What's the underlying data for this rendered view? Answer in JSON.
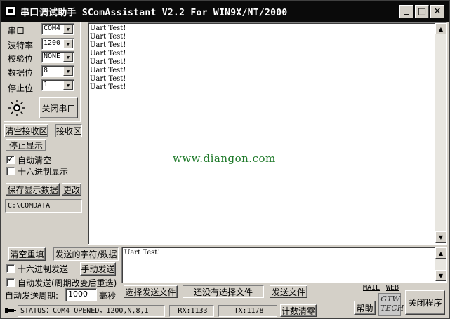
{
  "window": {
    "title": "串口调试助手 SComAssistant V2.2 For WIN9X/NT/2000",
    "minimize": "_",
    "maximize": "□",
    "close": "✕"
  },
  "settings": {
    "port_label": "串口",
    "port_value": "COM4",
    "baud_label": "波特率",
    "baud_value": "1200",
    "parity_label": "校验位",
    "parity_value": "NONE",
    "databits_label": "数据位",
    "databits_value": "8",
    "stopbits_label": "停止位",
    "stopbits_value": "1",
    "close_port_button": "关闭串口"
  },
  "receive": {
    "clear_recv_button": "清空接收区",
    "recv_area_label": "接收区",
    "stop_display_button": "停止显示",
    "auto_clear_label": "自动清空",
    "auto_clear_checked": true,
    "hex_display_label": "十六进制显示",
    "hex_display_checked": false,
    "save_data_button": "保存显示数据",
    "change_button": "更改",
    "save_path": "C:\\COMDATA",
    "lines": [
      "Uart Test!",
      "Uart Test!",
      "Uart Test!",
      "Uart Test!",
      "Uart Test!",
      "Uart Test!",
      "Uart Test!",
      "Uart Test!"
    ],
    "watermark": "www.diangon.com"
  },
  "send": {
    "clear_refill_button": "清空重填",
    "send_area_label": "发送的字符/数据",
    "hex_send_label": "十六进制发送",
    "hex_send_checked": false,
    "manual_send_button": "手动发送",
    "auto_send_label": "自动发送(周期改变后重选)",
    "auto_send_checked": false,
    "period_label": "自动发送周期:",
    "period_value": "1000",
    "period_unit": "毫秒",
    "select_file_button": "选择发送文件",
    "no_file_text": "还没有选择文件",
    "send_file_button": "发送文件",
    "send_text": "Uart Test!"
  },
  "links": {
    "mail": "MAIL",
    "web": "WEB"
  },
  "buttons": {
    "help": "帮助",
    "exit": "关闭程序"
  },
  "logo_text": "GTW TECH",
  "status": {
    "status_text": "STATUS：COM4 OPENED，1200,N,8,1",
    "rx_text": "RX:1133",
    "tx_text": "TX:1178",
    "reset_count_button": "计数清零"
  }
}
